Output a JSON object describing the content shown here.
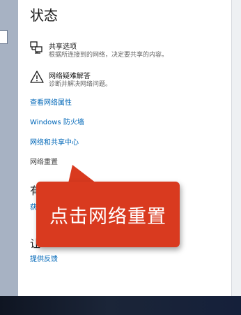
{
  "section_title": "状态",
  "options": [
    {
      "icon": "network-share-icon",
      "title": "共享选项",
      "desc": "根据所连接到的网络，决定要共享的内容。"
    },
    {
      "icon": "warning-triangle-icon",
      "title": "网络疑难解答",
      "desc": "诊断并解决网络问题。"
    }
  ],
  "links": {
    "view_properties": "查看网络属性",
    "firewall": "Windows 防火墙",
    "sharing_center": "网络和共享中心",
    "network_reset": "网络重置",
    "feedback": "提供反馈"
  },
  "partial": {
    "heading_1": "有",
    "link_1": "获",
    "heading_2": "让"
  },
  "callout": {
    "text": "点击网络重置"
  },
  "colors": {
    "accent_link": "#0067b8",
    "callout_bg": "#d93a1f"
  }
}
